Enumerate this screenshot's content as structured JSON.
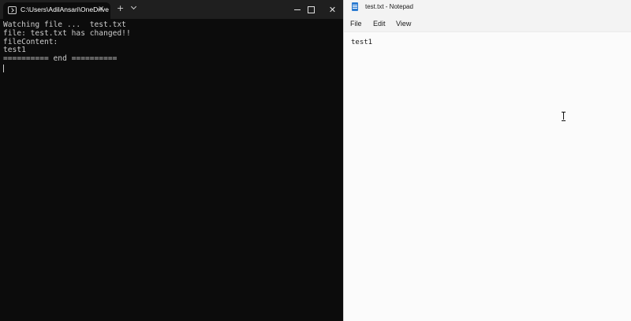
{
  "terminal": {
    "tab_title": "C:\\Users\\AdilAnsari\\OneDrive",
    "close_glyph": "×",
    "new_tab_glyph": "+",
    "close_window_glyph": "✕",
    "lines": [
      "Watching file ...  test.txt",
      "file: test.txt has changed!!",
      "fileContent:",
      "test1",
      "========== end =========="
    ],
    "colors": {
      "background": "#0c0c0c",
      "titlebar": "#1f1f1f",
      "text": "#cccccc"
    },
    "icons": {
      "tab": "terminal-icon",
      "dropdown": "chevron-down-icon"
    }
  },
  "notepad": {
    "window_title": "test.txt - Notepad",
    "menu": {
      "file": "File",
      "edit": "Edit",
      "view": "View"
    },
    "content": "test1",
    "colors": {
      "background": "#f9f9f9",
      "app_icon": "#2b7bd1"
    },
    "icons": {
      "app": "notepad-icon",
      "pointer": "text-cursor-icon"
    }
  }
}
